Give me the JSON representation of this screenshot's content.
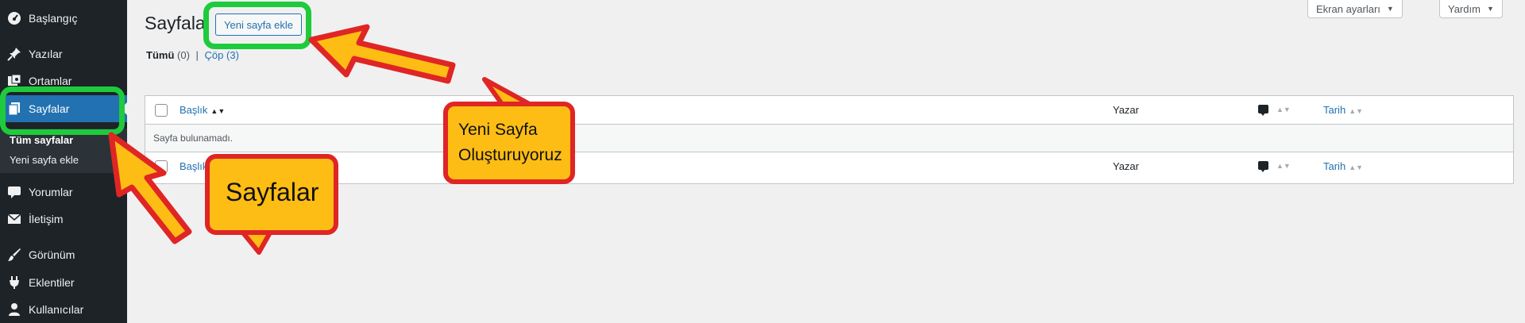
{
  "sidebar": {
    "items": [
      {
        "label": "Başlangıç",
        "icon": "dashboard-icon"
      },
      {
        "label": "Yazılar",
        "icon": "pushpin-icon"
      },
      {
        "label": "Ortamlar",
        "icon": "media-icon"
      },
      {
        "label": "Sayfalar",
        "icon": "pages-icon"
      },
      {
        "label": "Yorumlar",
        "icon": "comment-icon"
      },
      {
        "label": "İletişim",
        "icon": "email-icon"
      },
      {
        "label": "Görünüm",
        "icon": "brush-icon"
      },
      {
        "label": "Eklentiler",
        "icon": "plugin-icon"
      },
      {
        "label": "Kullanıcılar",
        "icon": "user-icon"
      }
    ],
    "submenu": [
      {
        "label": "Tüm sayfalar"
      },
      {
        "label": "Yeni sayfa ekle"
      }
    ]
  },
  "header": {
    "title": "Sayfala",
    "add_new": "Yeni sayfa ekle",
    "screen_options": "Ekran ayarları",
    "help": "Yardım"
  },
  "filters": {
    "all_label": "Tümü",
    "all_count": "(0)",
    "separator": "|",
    "trash_label": "Çöp",
    "trash_count": "(3)"
  },
  "table": {
    "columns": {
      "title": "Başlık",
      "author": "Yazar",
      "date": "Tarih"
    },
    "empty_message": "Sayfa bulunamadı."
  },
  "annotations": {
    "callout_new_line1": "Yeni Sayfa",
    "callout_new_line2": "Oluşturuyoruz",
    "callout_pages": "Sayfalar"
  },
  "colors": {
    "sidebar_bg": "#1d2327",
    "active_blue": "#2271b1",
    "highlight_green": "#1ecb3c",
    "arrow_red": "#e02525",
    "arrow_yellow": "#fdbd14"
  }
}
